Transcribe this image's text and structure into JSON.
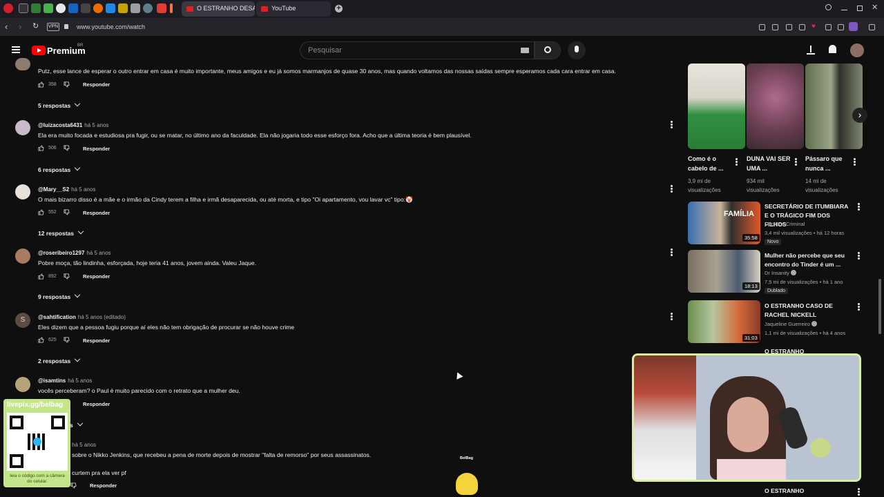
{
  "browser": {
    "tabs": [
      {
        "label": "O ESTRANHO DESAPARECIMENTO",
        "active": true
      },
      {
        "label": "YouTube",
        "active": false
      }
    ],
    "vpn_label": "VPN",
    "url": "www.youtube.com/watch"
  },
  "header": {
    "brand": "Premium",
    "region": "BR",
    "search_placeholder": "Pesquisar"
  },
  "comments": {
    "reply_label": "Responder",
    "items": [
      {
        "author": "",
        "time": "",
        "text": "Putz, esse lance de esperar o outro entrar em casa é muito importante, meus amigos e eu já somos marmanjos de quase 30 anos, mas quando voltamos das nossas saídas sempre esperamos cada cara entrar em casa.",
        "likes": "358",
        "replies": "5 respostas"
      },
      {
        "author": "@luizacosta6431",
        "time": "há 5 anos",
        "text": "Ela era muito focada e estudiosa pra fugir, ou se matar, no último ano da faculdade. Ela não jogaria todo esse esforço fora. Acho que a última teoria é bem plausível.",
        "likes": "506",
        "replies": "6 respostas"
      },
      {
        "author": "@Mary__S2",
        "time": "há 5 anos",
        "text": "O mais bizarro disso é a mãe e o irmão da Cindy terem a filha e irmã desaparecida, ou até morta, e tipo \"Oi apartamento, vou lavar vc\" tipo:🤡",
        "likes": "552",
        "replies": "12 respostas"
      },
      {
        "author": "@roseribeiro1297",
        "time": "há 5 anos",
        "text": "Pobre moça,  tão lindinha, esforçada,  hoje  teria 41 anos,  jovem  ainda.  Valeu Jaque.",
        "likes": "892",
        "replies": "9 respostas"
      },
      {
        "author": "@sahtification",
        "time": "há 5 anos (editado)",
        "text": "Eles dizem que a pessoa fugiu porque aí eles não tem obrigação de procurar se não houve crime",
        "likes": "625",
        "replies": "2 respostas"
      },
      {
        "author": "@isamtins",
        "time": "há 5 anos",
        "text": "vocês perceberam? o Paul é muito parecido com o retrato que a mulher deu.",
        "likes": "",
        "replies": "s"
      },
      {
        "author": "",
        "time": "há 5 anos",
        "text": "sobre o Nikko Jenkins, que  recebeu a pena de morte depois de mostrar \"falta de remorso\" por seus assassinatos.",
        "text2": "curtem pra ela ver pf",
        "likes": "",
        "replies": ""
      }
    ]
  },
  "shelf": [
    {
      "title": "Como é o cabelo de ...",
      "views": "3,9 mi de visualizações"
    },
    {
      "title": "DUNA VAI SER UMA ...",
      "views": "934 mil visualizações"
    },
    {
      "title": "Pássaro que nunca ...",
      "views": "14 mi de visualizações"
    }
  ],
  "videos": [
    {
      "title": "SECRETÁRIO DE ITUMBIARA E O TRÁGICO FIM DOS FILHOS",
      "channel": "Doc Doc Criminal",
      "meta": "3,4 mil visualizações  •  há 12 horas",
      "badge": "Novo",
      "duration": "35:58",
      "thumb_text": "FAMÍLIA"
    },
    {
      "title": "Mulher não percebe que seu encontro do Tinder é um ...",
      "channel": "Dr Insanity",
      "meta": "7,5 mi de visualizações  •  há 1 ano",
      "badge": "Dublado",
      "duration": "18:13"
    },
    {
      "title": "O ESTRANHO CASO DE RACHEL NICKELL",
      "channel": "Jaqueline Guerreiro",
      "meta": "1,1 mi de visualizações  •  há 4 anos",
      "badge": "",
      "duration": "31:03"
    },
    {
      "title": "O ESTRANHO",
      "channel": "",
      "meta": "",
      "badge": "",
      "duration": ""
    },
    {
      "title": "O ESTRANHO",
      "channel": "",
      "meta": "",
      "badge": "",
      "duration": ""
    }
  ],
  "overlay": {
    "qr_url": "livepix.gg/belbag",
    "qr_hint": "leia o código com a câmera do celular.",
    "cam_label": "BelBag"
  }
}
